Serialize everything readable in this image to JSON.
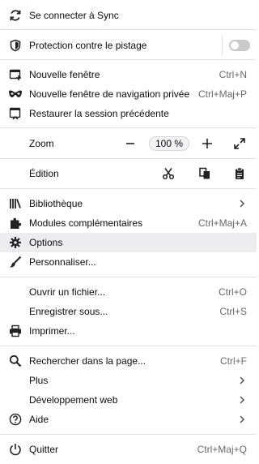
{
  "menu": {
    "sync": "Se connecter à Sync",
    "tracking": "Protection contre le pistage",
    "tracking_enabled": false,
    "new_window": {
      "label": "Nouvelle fenêtre",
      "shortcut": "Ctrl+N"
    },
    "private_window": {
      "label": "Nouvelle fenêtre de navigation privée",
      "shortcut": "Ctrl+Maj+P"
    },
    "restore": "Restaurer la session précédente",
    "zoom": {
      "label": "Zoom",
      "value": "100 %"
    },
    "edition": "Édition",
    "library": "Bibliothèque",
    "addons": {
      "label": "Modules complémentaires",
      "shortcut": "Ctrl+Maj+A"
    },
    "options": "Options",
    "customize": "Personnaliser...",
    "open_file": {
      "label": "Ouvrir un fichier...",
      "shortcut": "Ctrl+O"
    },
    "save_as": {
      "label": "Enregistrer sous...",
      "shortcut": "Ctrl+S"
    },
    "print": "Imprimer...",
    "find": {
      "label": "Rechercher dans la page...",
      "shortcut": "Ctrl+F"
    },
    "more": "Plus",
    "webdev": "Développement web",
    "help": "Aide",
    "quit": {
      "label": "Quitter",
      "shortcut": "Ctrl+Maj+Q"
    }
  }
}
